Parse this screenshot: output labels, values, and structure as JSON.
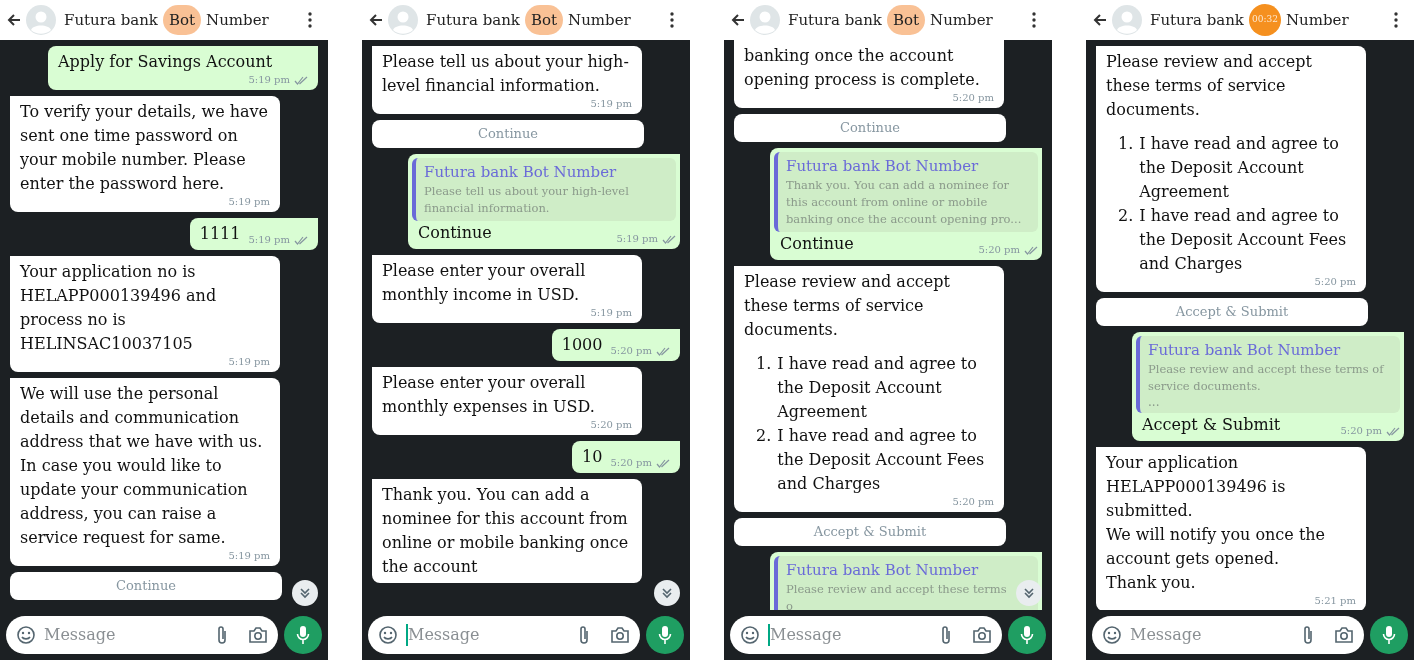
{
  "panels": [
    {
      "header": {
        "title_start": "Futura bank",
        "title_marked": "Bot",
        "title_end": "Number",
        "touch_highlight": true
      },
      "messages": [
        {
          "kind": "out",
          "text": "Apply for Savings Account",
          "time": "5:19 pm"
        },
        {
          "kind": "in",
          "text": "To verify your details, we have sent one time password on your mobile number. Please enter the password here.",
          "time": "5:19 pm"
        },
        {
          "kind": "out",
          "text": "1111",
          "time": "5:19 pm"
        },
        {
          "kind": "in",
          "text": "Your application no is HELAPP000139496 and process no is HELINSAC10037105",
          "time": "5:19 pm"
        },
        {
          "kind": "in",
          "text": "We will use the personal details and communication address that we have with us. In case you would like to update your communication address, you can raise a service request for same.",
          "time": "5:19 pm"
        },
        {
          "kind": "button",
          "text": "Continue"
        }
      ],
      "scroll_button": true,
      "input": {
        "placeholder": "Message",
        "focused": false
      }
    },
    {
      "header": {
        "title_start": "Futura bank",
        "title_marked": "Bot",
        "title_end": "Number",
        "touch_highlight": true
      },
      "messages": [
        {
          "kind": "in",
          "text": "Please tell us about your high-level financial information.",
          "time": "5:19 pm"
        },
        {
          "kind": "button",
          "text": "Continue"
        },
        {
          "kind": "reply",
          "quote_sender": "Futura bank Bot Number",
          "quote_text": "Please tell us about your high-level financial information.",
          "text": "Continue",
          "time": "5:19 pm"
        },
        {
          "kind": "in",
          "text": "Please enter your overall monthly income in USD.",
          "time": "5:19 pm"
        },
        {
          "kind": "out",
          "text": "1000",
          "time": "5:20 pm"
        },
        {
          "kind": "in",
          "text": "Please enter your overall monthly expenses in USD.",
          "time": "5:20 pm"
        },
        {
          "kind": "out",
          "text": "10",
          "time": "5:20 pm"
        },
        {
          "kind": "in",
          "text": "Thank you. You can add a nominee for this account from online or mobile banking once the account"
        }
      ],
      "scroll_button": true,
      "input": {
        "placeholder": "Message",
        "focused": true
      }
    },
    {
      "header": {
        "title_start": "Futura bank",
        "title_marked": "Bot",
        "title_end": "Number",
        "touch_highlight": true
      },
      "messages": [
        {
          "kind": "in",
          "text": "banking once the account opening process is complete.",
          "time": "5:20 pm",
          "cut_top": true
        },
        {
          "kind": "button",
          "text": "Continue"
        },
        {
          "kind": "reply",
          "quote_sender": "Futura bank Bot Number",
          "quote_text": "Thank you. You can add a nominee for this account from online or mobile banking once the account opening pro...",
          "text": "Continue",
          "time": "5:20 pm"
        },
        {
          "kind": "in",
          "text": "Please review and accept these terms of service documents.",
          "list": [
            {
              "number": "1.",
              "text": "I have read and agree to the Deposit Account Agreement"
            },
            {
              "number": "2.",
              "text": "I have read and agree to the Deposit Account Fees and Charges"
            }
          ],
          "time": "5:20 pm"
        },
        {
          "kind": "button",
          "text": "Accept & Submit"
        },
        {
          "kind": "reply",
          "quote_sender": "Futura bank Bot Number",
          "quote_text": "Please review and accept these terms o"
        }
      ],
      "scroll_button": true,
      "input": {
        "placeholder": "Message",
        "focused": true
      }
    },
    {
      "header": {
        "title_start": "Futura bank",
        "title_end": "Number",
        "timer": "00:32"
      },
      "messages": [
        {
          "kind": "in",
          "text": "Please review and accept these terms of service documents.",
          "list": [
            {
              "number": "1.",
              "text": "I have read and agree to the Deposit Account Agreement"
            },
            {
              "number": "2.",
              "text": "I have read and agree to the Deposit Account Fees and Charges"
            }
          ],
          "time": "5:20 pm"
        },
        {
          "kind": "button",
          "text": "Accept & Submit"
        },
        {
          "kind": "reply",
          "quote_sender": "Futura bank Bot Number",
          "quote_text": "Please review and accept these terms of service documents.",
          "quote_more": "...",
          "text": "Accept & Submit",
          "time": "5:20 pm"
        },
        {
          "kind": "in",
          "paragraphs": [
            "Your application HELAPP000139496 is submitted.",
            "We will notify you once the account gets opened.",
            "Thank you."
          ],
          "time": "5:21 pm"
        }
      ],
      "input": {
        "placeholder": "Message",
        "focused": false
      }
    }
  ]
}
